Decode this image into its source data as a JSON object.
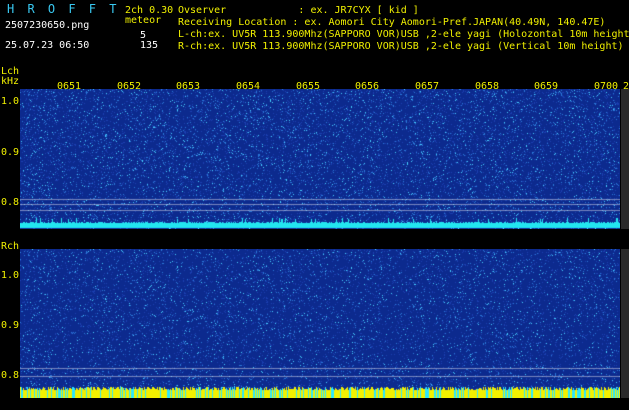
{
  "header": {
    "logo": "H R O F F T",
    "version": "2ch 0.30",
    "filename": "2507230650.png",
    "datetime": "25.07.23 06:50",
    "meteor_label": "meteor",
    "meteor_l": "5",
    "meteor_r": "135",
    "observer": "Ovserver            : ex. JR7CYX [ kid ]",
    "location": "Receiving Location : ex. Aomori City Aomori-Pref.JAPAN(40.49N, 140.47E)",
    "lch": "L-ch:ex. UV5R 113.900Mhz(SAPPORO VOR)USB ,2-ele yagi (Holozontal 10m height",
    "rch": "R-ch:ex. UV5R 113.900Mhz(SAPPORO VOR)USB ,2-ele yagi (Vertical 10m height)"
  },
  "time_ticks": [
    "0651",
    "0652",
    "0653",
    "0654",
    "0655",
    "0656",
    "0657",
    "0658",
    "0659",
    "0700"
  ],
  "time_tick_extra": "2",
  "left_panel": {
    "label_l": "Lch",
    "unit": "kHz",
    "label_r": "Rch",
    "ticks": [
      "1.0",
      "0.9",
      "0.8"
    ]
  },
  "colors": {
    "background": "#000000",
    "panel_base": "#0c2a8e",
    "noise_low": "#1a3fb0",
    "noise_mid": "#2a78d8",
    "noise_high": "#46d0ff",
    "lch_band": "#22e6f0",
    "rch_band_yellow": "#f2f000",
    "rch_band_cyan": "#2ae6ff",
    "text_yellow": "#f0f000"
  }
}
